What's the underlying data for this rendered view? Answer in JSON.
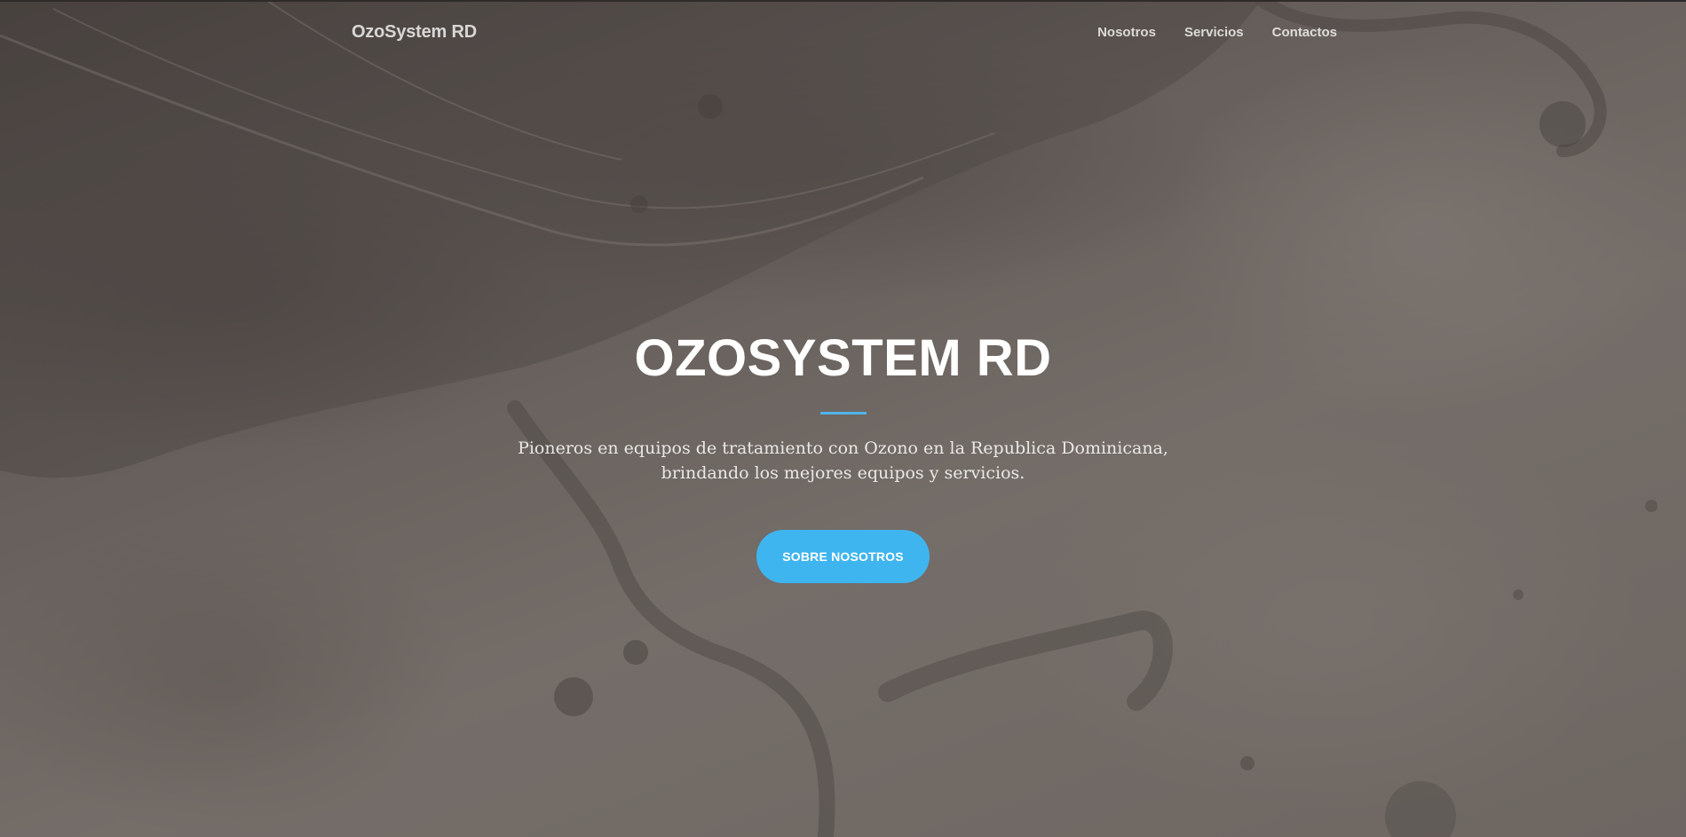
{
  "navbar": {
    "brand": "OzoSystem RD",
    "links": [
      {
        "label": "Nosotros"
      },
      {
        "label": "Servicios"
      },
      {
        "label": "Contactos"
      }
    ]
  },
  "hero": {
    "title": "OZOSYSTEM RD",
    "subtitle_line1": "Pioneros en equipos de tratamiento con Ozono en la Republica Dominicana,",
    "subtitle_line2": "brindando los mejores equipos y servicios.",
    "cta_label": "SOBRE NOSOTROS"
  },
  "colors": {
    "accent": "#3fb5ef",
    "divider": "#4fb4e8",
    "background": "#6d6762"
  },
  "icons": {
    "background_image": "water-splash-image"
  }
}
